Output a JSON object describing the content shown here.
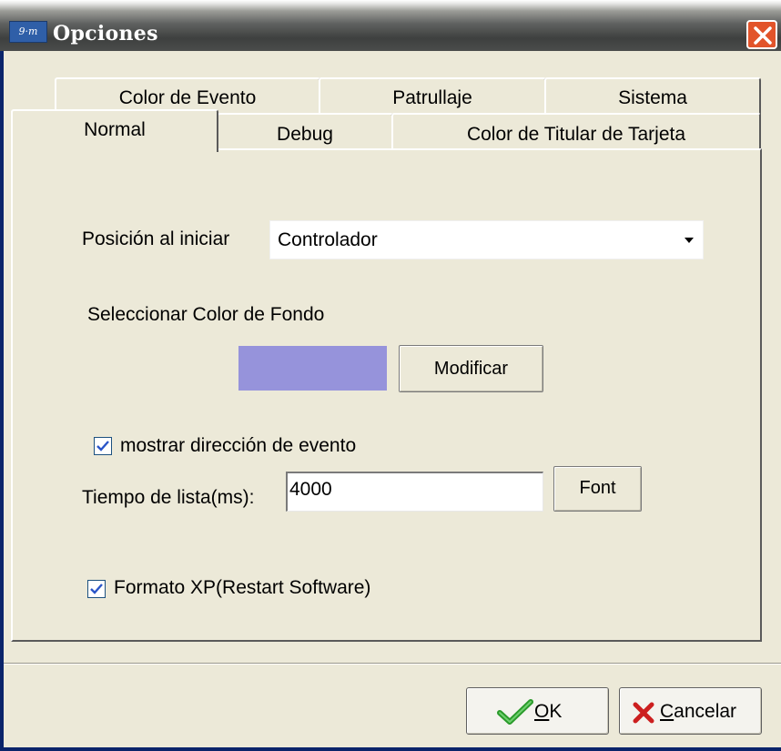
{
  "window": {
    "title": "Opciones",
    "icon_text": "9·m"
  },
  "tabs": {
    "back_row": [
      "Color de Evento",
      "Patrullaje",
      "Sistema"
    ],
    "front_row": [
      "Normal",
      "Debug",
      "Color de Titular de Tarjeta"
    ],
    "active": "Normal"
  },
  "form": {
    "start_position_label": "Posición al iniciar",
    "start_position_value": "Controlador",
    "bg_color_label": "Seleccionar Color de Fondo",
    "bg_color_hex": "#9693db",
    "modify_button": "Modificar",
    "show_direction_label": "mostrar dirección de evento",
    "show_direction_checked": true,
    "list_time_label": "Tiempo de lista(ms):",
    "list_time_value": "4000",
    "font_button": "Font",
    "xp_format_label": "Formato XP(Restart Software)",
    "xp_format_checked": true
  },
  "footer": {
    "ok_label": "OK",
    "ok_mnemonic": "O",
    "ok_rest": "K",
    "cancel_label": "Cancelar",
    "cancel_mnemonic": "C",
    "cancel_rest": "ancelar"
  },
  "icons": {
    "ok": "checkmark-icon",
    "cancel": "red-x-icon",
    "close": "close-icon",
    "dropdown": "chevron-down-icon"
  }
}
